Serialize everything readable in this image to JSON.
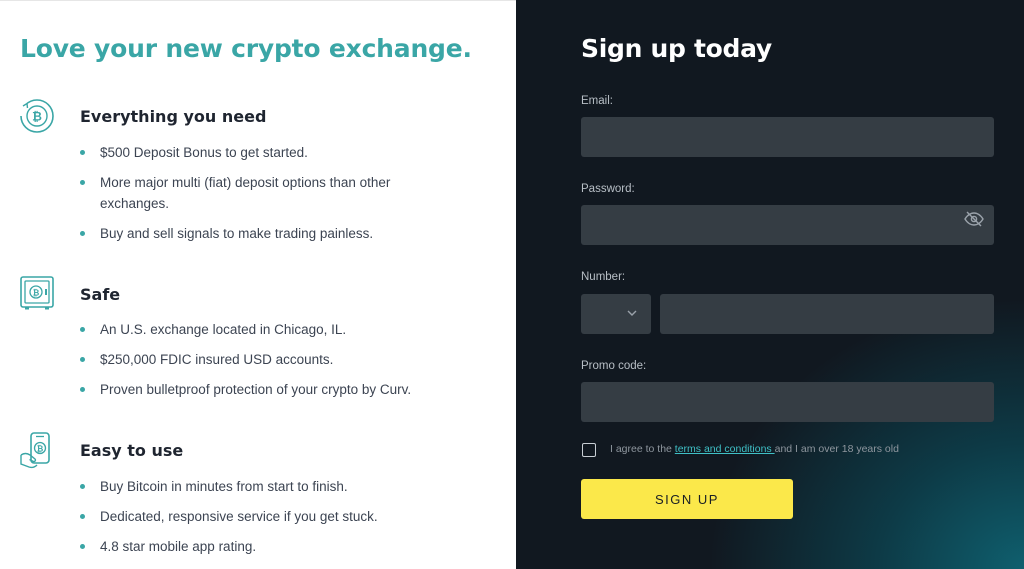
{
  "left": {
    "headline": "Love your new crypto exchange.",
    "features": [
      {
        "icon": "bitcoin-cycle-icon",
        "title": "Everything you need",
        "bullets": [
          "$500 Deposit Bonus to get started.",
          "More major multi (fiat) deposit options than other exchanges.",
          "Buy and sell signals to make trading painless."
        ]
      },
      {
        "icon": "bitcoin-safe-icon",
        "title": "Safe",
        "bullets": [
          "An U.S. exchange located in Chicago, IL.",
          "$250,000 FDIC insured USD accounts.",
          "Proven bulletproof protection of your crypto by Curv."
        ]
      },
      {
        "icon": "bitcoin-phone-hand-icon",
        "title": "Easy to use",
        "bullets": [
          "Buy Bitcoin in minutes from start to finish.",
          "Dedicated, responsive service if you get stuck.",
          "4.8 star mobile app rating."
        ]
      }
    ]
  },
  "signup": {
    "title": "Sign up today",
    "email_label": "Email:",
    "email_value": "",
    "password_label": "Password:",
    "password_value": "",
    "number_label": "Number:",
    "number_value": "",
    "promo_label": "Promo code:",
    "promo_value": "",
    "agree_prefix": "I agree to the ",
    "agree_link": "terms and conditions ",
    "agree_suffix": "and I am over 18 years old",
    "button_label": "SIGN UP"
  },
  "colors": {
    "accent_teal": "#3aa6a6",
    "button_yellow": "#fbe84a",
    "panel_dark": "#111820",
    "input_bg": "#353d44"
  }
}
